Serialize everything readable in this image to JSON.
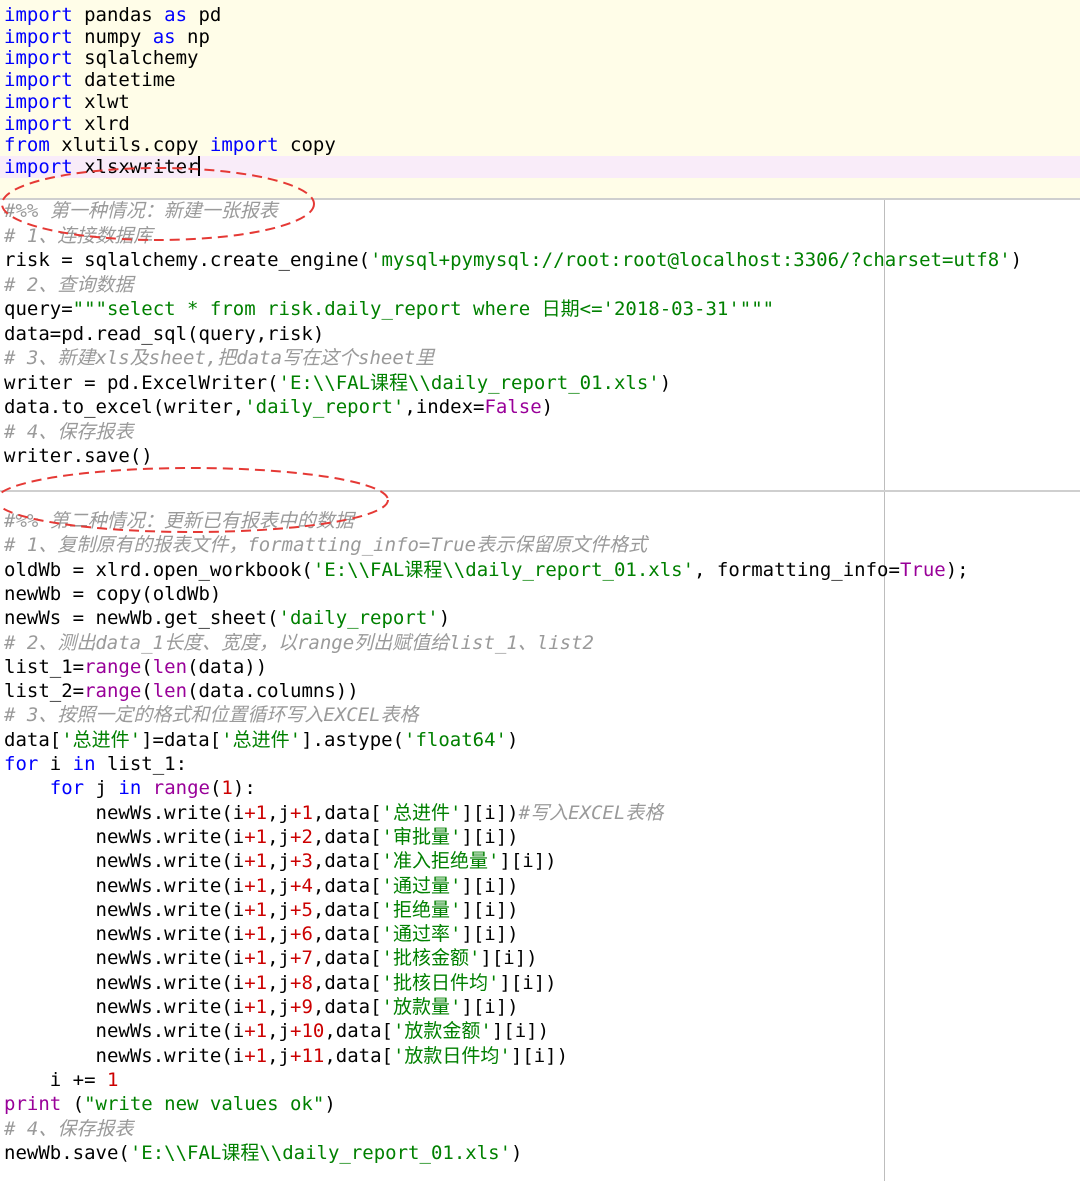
{
  "colors": {
    "keyword": "#0000ff",
    "string": "#008000",
    "number": "#cc0000",
    "builtin": "#990099",
    "comment": "#9a9a9a",
    "cell_highlight": "#fffde8",
    "current_line": "#f9ecf9",
    "annotation": "#e53935"
  },
  "icons": {
    "cursor": "text-cursor-icon",
    "annotation": "red-dashed-ellipse"
  },
  "cells": [
    {
      "id": "imports",
      "lines": [
        [
          [
            "kw",
            "import"
          ],
          [
            "txt",
            " pandas "
          ],
          [
            "kw",
            "as"
          ],
          [
            "txt",
            " pd"
          ]
        ],
        [
          [
            "kw",
            "import"
          ],
          [
            "txt",
            " numpy "
          ],
          [
            "kw",
            "as"
          ],
          [
            "txt",
            " np"
          ]
        ],
        [
          [
            "kw",
            "import"
          ],
          [
            "txt",
            " sqlalchemy"
          ]
        ],
        [
          [
            "kw",
            "import"
          ],
          [
            "txt",
            " datetime"
          ]
        ],
        [
          [
            "kw",
            "import"
          ],
          [
            "txt",
            " xlwt"
          ]
        ],
        [
          [
            "kw",
            "import"
          ],
          [
            "txt",
            " xlrd"
          ]
        ],
        [
          [
            "kw",
            "from"
          ],
          [
            "txt",
            " xlutils.copy "
          ],
          [
            "kw",
            "import"
          ],
          [
            "txt",
            " copy"
          ]
        ],
        [
          [
            "kw",
            "import"
          ],
          [
            "txt",
            " xlsxwriter"
          ],
          [
            "cursor",
            ""
          ]
        ]
      ]
    },
    {
      "id": "case1",
      "lines": [
        [
          [
            "cm",
            "#%% 第一种情况：新建一张报表"
          ]
        ],
        [
          [
            "cm",
            "# 1、连接数据库"
          ]
        ],
        [
          [
            "txt",
            "risk = sqlalchemy.create_engine("
          ],
          [
            "str",
            "'mysql+pymysql://root:root@localhost:3306/?charset=utf8'"
          ],
          [
            "txt",
            ")"
          ]
        ],
        [
          [
            "cm",
            "# 2、查询数据"
          ]
        ],
        [
          [
            "txt",
            "query="
          ],
          [
            "str",
            "\"\"\"select * from risk.daily_report where 日期<='2018-03-31'\"\"\""
          ]
        ],
        [
          [
            "txt",
            "data=pd.read_sql(query,risk)"
          ]
        ],
        [
          [
            "cm",
            "# 3、新建xls及sheet,把data写在这个sheet里"
          ]
        ],
        [
          [
            "txt",
            "writer = pd.ExcelWriter("
          ],
          [
            "str",
            "'E:\\\\FAL课程\\\\daily_report_01.xls'"
          ],
          [
            "txt",
            ")"
          ]
        ],
        [
          [
            "txt",
            "data.to_excel(writer,"
          ],
          [
            "str",
            "'daily_report'"
          ],
          [
            "txt",
            ",index="
          ],
          [
            "bi",
            "False"
          ],
          [
            "txt",
            ")"
          ]
        ],
        [
          [
            "cm",
            "# 4、保存报表"
          ]
        ],
        [
          [
            "txt",
            "writer.save()"
          ]
        ]
      ]
    },
    {
      "id": "case2",
      "lines": [
        [
          [
            "cm",
            "#%% 第二种情况：更新已有报表中的数据"
          ]
        ],
        [
          [
            "cm",
            "# 1、复制原有的报表文件，formatting_info=True表示保留原文件格式"
          ]
        ],
        [
          [
            "txt",
            "oldWb = xlrd.open_workbook("
          ],
          [
            "str",
            "'E:\\\\FAL课程\\\\daily_report_01.xls'"
          ],
          [
            "txt",
            ", formatting_info="
          ],
          [
            "bi",
            "True"
          ],
          [
            "txt",
            ");"
          ]
        ],
        [
          [
            "txt",
            "newWb = copy(oldWb)"
          ]
        ],
        [
          [
            "txt",
            "newWs = newWb.get_sheet("
          ],
          [
            "str",
            "'daily_report'"
          ],
          [
            "txt",
            ")"
          ]
        ],
        [
          [
            "cm",
            "# 2、测出data_1长度、宽度，以range列出赋值给list_1、list2"
          ]
        ],
        [
          [
            "txt",
            "list_1="
          ],
          [
            "bi",
            "range"
          ],
          [
            "txt",
            "("
          ],
          [
            "bi",
            "len"
          ],
          [
            "txt",
            "(data))"
          ]
        ],
        [
          [
            "txt",
            "list_2="
          ],
          [
            "bi",
            "range"
          ],
          [
            "txt",
            "("
          ],
          [
            "bi",
            "len"
          ],
          [
            "txt",
            "(data.columns))"
          ]
        ],
        [
          [
            "cm",
            "# 3、按照一定的格式和位置循环写入EXCEL表格"
          ]
        ],
        [
          [
            "txt",
            "data["
          ],
          [
            "str",
            "'总进件'"
          ],
          [
            "txt",
            "]=data["
          ],
          [
            "str",
            "'总进件'"
          ],
          [
            "txt",
            "].astype("
          ],
          [
            "str",
            "'float64'"
          ],
          [
            "txt",
            ")"
          ]
        ],
        [
          [
            "kw",
            "for"
          ],
          [
            "txt",
            " i "
          ],
          [
            "kw",
            "in"
          ],
          [
            "txt",
            " list_1:"
          ]
        ],
        [
          [
            "txt",
            "    "
          ],
          [
            "kw",
            "for"
          ],
          [
            "txt",
            " j "
          ],
          [
            "kw",
            "in"
          ],
          [
            "txt",
            " "
          ],
          [
            "bi",
            "range"
          ],
          [
            "txt",
            "("
          ],
          [
            "num",
            "1"
          ],
          [
            "txt",
            "):"
          ]
        ],
        [
          [
            "txt",
            "        newWs.write(i"
          ],
          [
            "num",
            "+1"
          ],
          [
            "txt",
            ",j"
          ],
          [
            "num",
            "+1"
          ],
          [
            "txt",
            ",data["
          ],
          [
            "str",
            "'总进件'"
          ],
          [
            "txt",
            "][i])"
          ],
          [
            "cm",
            "#写入EXCEL表格"
          ]
        ],
        [
          [
            "txt",
            "        newWs.write(i"
          ],
          [
            "num",
            "+1"
          ],
          [
            "txt",
            ",j"
          ],
          [
            "num",
            "+2"
          ],
          [
            "txt",
            ",data["
          ],
          [
            "str",
            "'审批量'"
          ],
          [
            "txt",
            "][i])"
          ]
        ],
        [
          [
            "txt",
            "        newWs.write(i"
          ],
          [
            "num",
            "+1"
          ],
          [
            "txt",
            ",j"
          ],
          [
            "num",
            "+3"
          ],
          [
            "txt",
            ",data["
          ],
          [
            "str",
            "'准入拒绝量'"
          ],
          [
            "txt",
            "][i])"
          ]
        ],
        [
          [
            "txt",
            "        newWs.write(i"
          ],
          [
            "num",
            "+1"
          ],
          [
            "txt",
            ",j"
          ],
          [
            "num",
            "+4"
          ],
          [
            "txt",
            ",data["
          ],
          [
            "str",
            "'通过量'"
          ],
          [
            "txt",
            "][i])"
          ]
        ],
        [
          [
            "txt",
            "        newWs.write(i"
          ],
          [
            "num",
            "+1"
          ],
          [
            "txt",
            ",j"
          ],
          [
            "num",
            "+5"
          ],
          [
            "txt",
            ",data["
          ],
          [
            "str",
            "'拒绝量'"
          ],
          [
            "txt",
            "][i])"
          ]
        ],
        [
          [
            "txt",
            "        newWs.write(i"
          ],
          [
            "num",
            "+1"
          ],
          [
            "txt",
            ",j"
          ],
          [
            "num",
            "+6"
          ],
          [
            "txt",
            ",data["
          ],
          [
            "str",
            "'通过率'"
          ],
          [
            "txt",
            "][i])"
          ]
        ],
        [
          [
            "txt",
            "        newWs.write(i"
          ],
          [
            "num",
            "+1"
          ],
          [
            "txt",
            ",j"
          ],
          [
            "num",
            "+7"
          ],
          [
            "txt",
            ",data["
          ],
          [
            "str",
            "'批核金额'"
          ],
          [
            "txt",
            "][i])"
          ]
        ],
        [
          [
            "txt",
            "        newWs.write(i"
          ],
          [
            "num",
            "+1"
          ],
          [
            "txt",
            ",j"
          ],
          [
            "num",
            "+8"
          ],
          [
            "txt",
            ",data["
          ],
          [
            "str",
            "'批核日件均'"
          ],
          [
            "txt",
            "][i])"
          ]
        ],
        [
          [
            "txt",
            "        newWs.write(i"
          ],
          [
            "num",
            "+1"
          ],
          [
            "txt",
            ",j"
          ],
          [
            "num",
            "+9"
          ],
          [
            "txt",
            ",data["
          ],
          [
            "str",
            "'放款量'"
          ],
          [
            "txt",
            "][i])"
          ]
        ],
        [
          [
            "txt",
            "        newWs.write(i"
          ],
          [
            "num",
            "+1"
          ],
          [
            "txt",
            ",j"
          ],
          [
            "num",
            "+10"
          ],
          [
            "txt",
            ",data["
          ],
          [
            "str",
            "'放款金额'"
          ],
          [
            "txt",
            "][i])"
          ]
        ],
        [
          [
            "txt",
            "        newWs.write(i"
          ],
          [
            "num",
            "+1"
          ],
          [
            "txt",
            ",j"
          ],
          [
            "num",
            "+11"
          ],
          [
            "txt",
            ",data["
          ],
          [
            "str",
            "'放款日件均'"
          ],
          [
            "txt",
            "][i])"
          ]
        ],
        [
          [
            "txt",
            "    i += "
          ],
          [
            "num",
            "1"
          ]
        ],
        [
          [
            "bi",
            "print"
          ],
          [
            "txt",
            " ("
          ],
          [
            "str",
            "\"write new values ok\""
          ],
          [
            "txt",
            ")"
          ]
        ],
        [
          [
            "cm",
            "# 4、保存报表"
          ]
        ],
        [
          [
            "txt",
            "newWb.save("
          ],
          [
            "str",
            "'E:\\\\FAL课程\\\\daily_report_01.xls'"
          ],
          [
            "txt",
            ")"
          ]
        ]
      ]
    }
  ]
}
